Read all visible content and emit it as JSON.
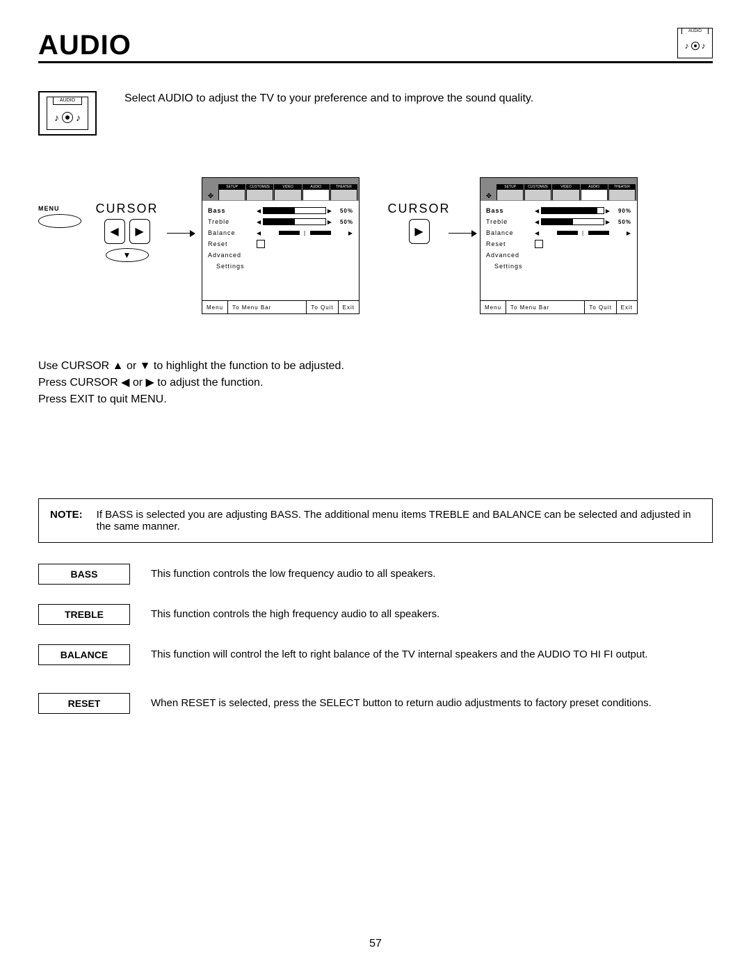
{
  "header": {
    "title": "AUDIO",
    "icon_label": "AUDIO"
  },
  "intro": {
    "icon_label": "AUDIO",
    "text": "Select AUDIO to adjust the TV to your preference and to improve the sound quality."
  },
  "controls": {
    "menu_label": "MENU",
    "cursor_label": "CURSOR"
  },
  "osd_tabs": [
    "SETUP",
    "CUSTOMIZE",
    "VIDEO",
    "AUDIO",
    "THEATER"
  ],
  "osd_left": {
    "bass": {
      "label": "Bass",
      "percent": "50%",
      "fill": 50
    },
    "treble": {
      "label": "Treble",
      "percent": "50%",
      "fill": 50
    },
    "balance": "Balance",
    "reset": "Reset",
    "advanced": "Advanced",
    "settings": "Settings",
    "footer": {
      "menu": "Menu",
      "bar": "To Menu Bar",
      "quit": "To Quit",
      "exit": "Exit"
    }
  },
  "osd_right": {
    "bass": {
      "label": "Bass",
      "percent": "90%",
      "fill": 90
    },
    "treble": {
      "label": "Treble",
      "percent": "50%",
      "fill": 50
    },
    "balance": "Balance",
    "reset": "Reset",
    "advanced": "Advanced",
    "settings": "Settings",
    "footer": {
      "menu": "Menu",
      "bar": "To Menu Bar",
      "quit": "To Quit",
      "exit": "Exit"
    }
  },
  "instructions": {
    "l1": "Use CURSOR ▲ or ▼ to highlight the function to be adjusted.",
    "l2": "Press CURSOR ◀ or ▶ to adjust the function.",
    "l3": "Press EXIT to quit MENU."
  },
  "note": {
    "label": "NOTE:",
    "text": "If BASS is selected you are adjusting BASS.  The additional menu items TREBLE and BALANCE can be selected and adjusted in the same manner."
  },
  "defs": {
    "bass": {
      "label": "BASS",
      "text": "This function controls the low frequency audio to all speakers."
    },
    "treble": {
      "label": "TREBLE",
      "text": "This function controls the high frequency audio to all speakers."
    },
    "balance": {
      "label": "BALANCE",
      "text": "This function will control the left to right balance of the TV internal speakers and the AUDIO TO HI FI output."
    },
    "reset": {
      "label": "RESET",
      "text": "When RESET is selected, press the SELECT button to return audio adjustments to factory preset conditions."
    }
  },
  "page_number": "57"
}
